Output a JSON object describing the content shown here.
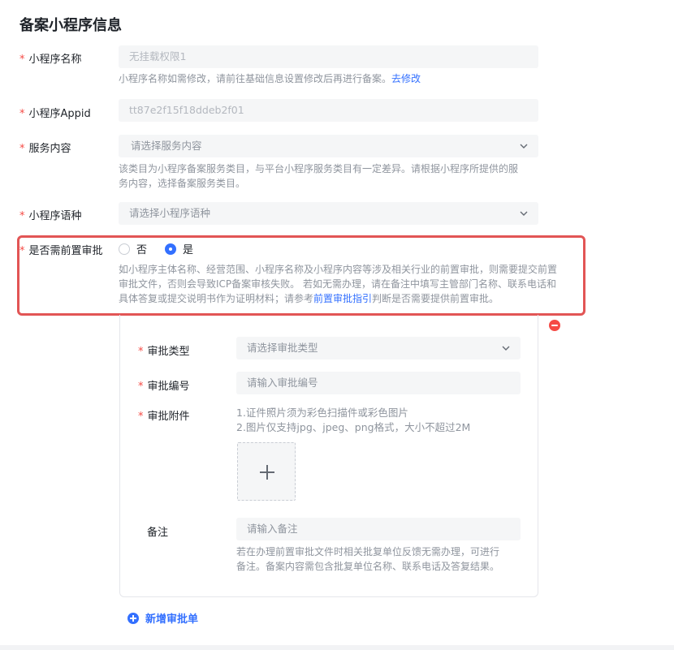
{
  "page": {
    "title": "备案小程序信息"
  },
  "required_mark": "*",
  "fields": {
    "name": {
      "label": "小程序名称",
      "value": "无挂载权限1",
      "hint": "小程序名称如需修改，请前往基础信息设置修改后再进行备案。",
      "hint_link": "去修改"
    },
    "appid": {
      "label": "小程序Appid",
      "value": "tt87e2f15f18ddeb2f01"
    },
    "service": {
      "label": "服务内容",
      "placeholder": "请选择服务内容",
      "hint_line1": "该类目为小程序备案服务类目，与平台小程序服务类目有一定差异。请根据小程序所提供的服",
      "hint_line2": "务内容，选择备案服务类目。"
    },
    "language": {
      "label": "小程序语种",
      "placeholder": "请选择小程序语种"
    },
    "pre_approval": {
      "label": "是否需前置审批",
      "options": [
        {
          "label": "否",
          "checked": false
        },
        {
          "label": "是",
          "checked": true
        }
      ],
      "hint_line1": "如小程序主体名称、经营范围、小程序名称及小程序内容等涉及相关行业的前置审批，则需要提交前置",
      "hint_line2": "审批文件，否则会导致ICP备案审核失败。 若如无需办理，请在备注中填写主管部门名称、联系电话和",
      "hint_line3_prefix": "具体答复或提交说明书作为证明材料；请参考",
      "hint_link": "前置审批指引",
      "hint_line3_suffix": "判断是否需要提供前置审批。"
    }
  },
  "approval_card": {
    "type": {
      "label": "审批类型",
      "placeholder": "请选择审批类型"
    },
    "number": {
      "label": "审批编号",
      "placeholder": "请输入审批编号"
    },
    "attachment": {
      "label": "审批附件",
      "rule1": "1.证件照片须为彩色扫描件或彩色图片",
      "rule2": "2.图片仅支持jpg、jpeg、png格式，大小不超过2M"
    },
    "remark": {
      "label": "备注",
      "placeholder": "请输入备注",
      "hint_line1": "若在办理前置审批文件时相关批复单位反馈无需办理，可进行",
      "hint_line2": "备注。备案内容需包含批复单位名称、联系电话及答复结果。"
    }
  },
  "add_button": {
    "label": "新增审批单"
  },
  "colors": {
    "accent": "#3370ff",
    "required": "#f54a45",
    "highlight": "#e25555"
  }
}
